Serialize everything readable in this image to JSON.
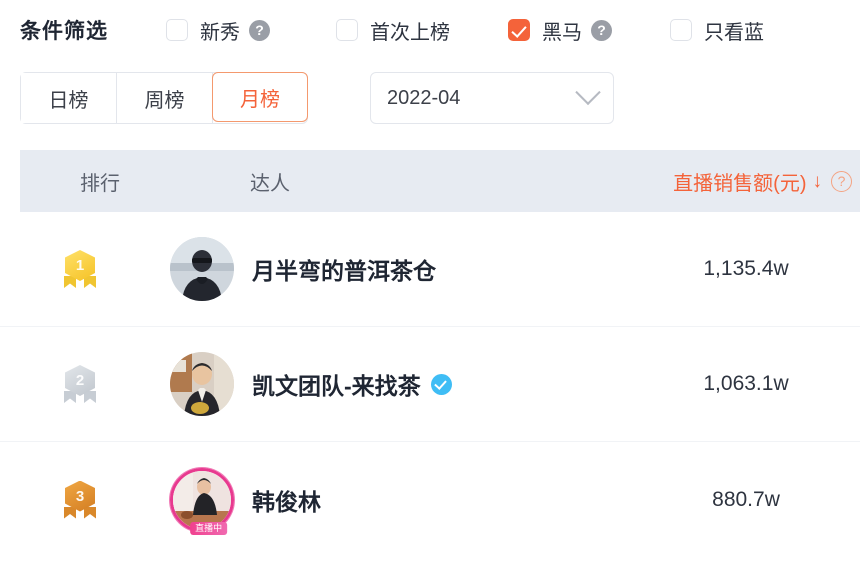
{
  "filter_bar": {
    "title": "条件筛选",
    "options": [
      {
        "label": "新秀",
        "checked": false,
        "has_help": true,
        "help_icon": "question-mark-icon"
      },
      {
        "label": "首次上榜",
        "checked": false,
        "has_help": false,
        "help_icon": ""
      },
      {
        "label": "黑马",
        "checked": true,
        "has_help": true,
        "help_icon": "question-mark-icon"
      },
      {
        "label": "只看蓝",
        "checked": false,
        "has_help": false,
        "help_icon": ""
      }
    ]
  },
  "controls": {
    "tabs": [
      {
        "label": "日榜",
        "active": false
      },
      {
        "label": "周榜",
        "active": false
      },
      {
        "label": "月榜",
        "active": true
      }
    ],
    "date_select": {
      "value": "2022-04",
      "chevron_icon": "chevron-down-icon"
    }
  },
  "table": {
    "headers": {
      "rank": "排行",
      "host": "达人",
      "sales": "直播销售额(元)",
      "sort_arrow": "↓",
      "sales_help_icon": "question-mark-icon"
    },
    "rows": [
      {
        "rank": "1",
        "medal": "gold",
        "name": "月半弯的普洱茶仓",
        "verified": false,
        "live": false,
        "live_label": "",
        "sales": "1,135.4w"
      },
      {
        "rank": "2",
        "medal": "silver",
        "name": "凯文团队-来找茶",
        "verified": true,
        "live": false,
        "live_label": "",
        "sales": "1,063.1w"
      },
      {
        "rank": "3",
        "medal": "bronze",
        "name": "韩俊林",
        "verified": false,
        "live": true,
        "live_label": "直播中",
        "sales": "880.7w"
      }
    ]
  },
  "colors": {
    "accent": "#f4633a",
    "header_bg": "#e7ebf2",
    "verified_blue": "#3fbdf5",
    "live_pink": "#e8398f"
  }
}
